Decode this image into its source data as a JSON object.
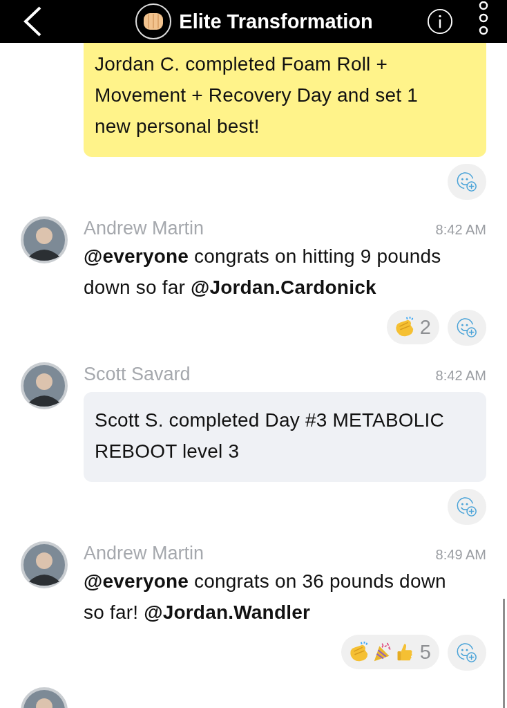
{
  "header": {
    "title": "Elite Transformation"
  },
  "messages": [
    {
      "kind": "card",
      "color": "#fff38a",
      "text": "Jordan C. completed Foam Roll + Movement + Recovery Day and set 1 new personal best!"
    },
    {
      "kind": "post",
      "author": "Andrew Martin",
      "time": "8:42 AM",
      "text": "**@everyone** congrats on hitting 9 pounds down so far **@Jordan.Cardonick**",
      "reactions": [
        {
          "emojis": [
            {
              "kind": "clap"
            }
          ],
          "count": "2"
        }
      ]
    },
    {
      "kind": "card",
      "color": "#eff1f5",
      "author": "Scott Savard",
      "time": "8:42 AM",
      "text": "Scott S. completed Day #3 METABOLIC REBOOT level 3"
    },
    {
      "kind": "post",
      "author": "Andrew Martin",
      "time": "8:49 AM",
      "text": "**@everyone** congrats on 36 pounds down so far! **@Jordan.Wandler**",
      "reactions": [
        {
          "emojis": [
            {
              "kind": "clap"
            },
            {
              "kind": "party"
            },
            {
              "kind": "thumbs-up"
            }
          ],
          "count": "5"
        }
      ]
    }
  ]
}
